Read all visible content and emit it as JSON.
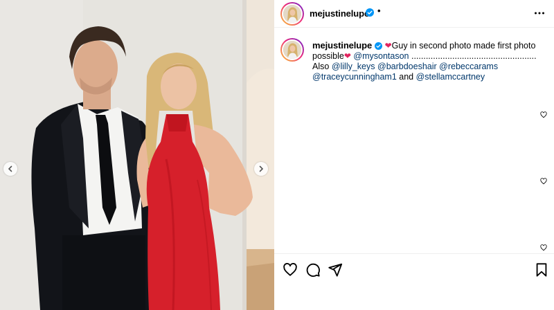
{
  "post": {
    "username": "mejustinelupe",
    "header_separator": "•",
    "caption": {
      "username": "mejustinelupe",
      "text_1": "Guy in second photo made first photo possible",
      "mention_1": "@mysontason",
      "text_2": " .................................................... Also",
      "mention_2": "@lilly_keys",
      "mention_3": "@barbdoeshair",
      "mention_4": "@rebeccarams",
      "mention_5": "@tracеycunningham1",
      "text_3": " and ",
      "mention_6": "@stellamccartney"
    }
  },
  "icons": {
    "verified": "verified-badge-icon",
    "more": "more-options-icon",
    "heart": "heart-emoji",
    "like": "like-icon",
    "comment": "comment-icon",
    "share": "share-icon",
    "save": "save-icon",
    "prev": "chevron-left-icon",
    "next": "chevron-right-icon"
  },
  "colors": {
    "verified": "#0095f6",
    "mention": "#00376b",
    "heart_emoji": "#e0245e",
    "avatar_ring_start": "#f9ce34",
    "avatar_ring_end": "#6228d7"
  }
}
